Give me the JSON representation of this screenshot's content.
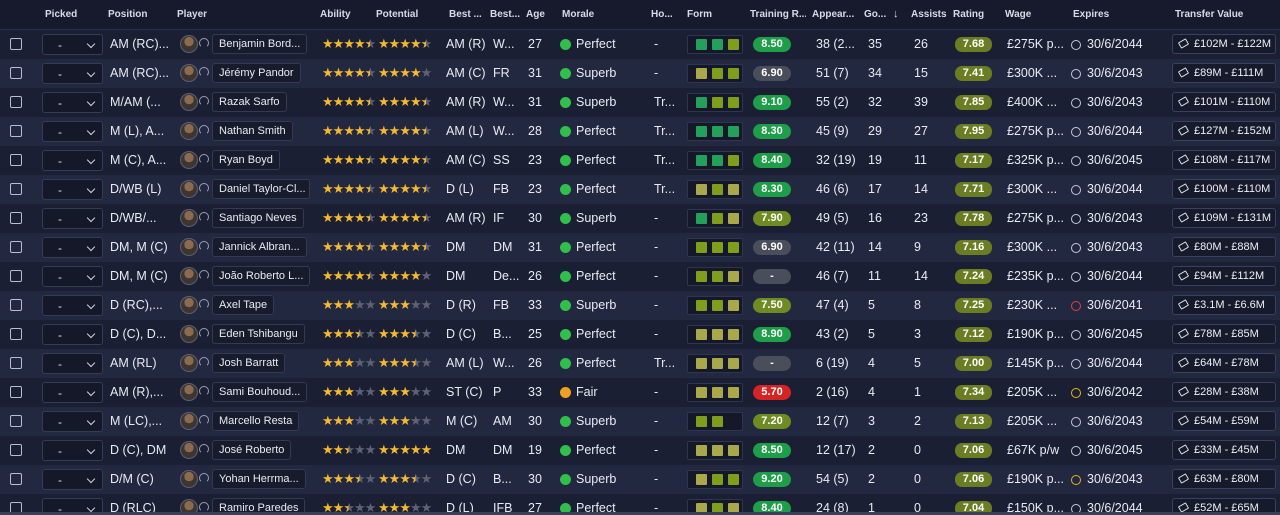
{
  "headers": {
    "picked": "Picked",
    "position": "Position",
    "player": "Player",
    "ability": "Ability",
    "potential": "Potential",
    "best_pos": "Best ...",
    "best_role": "Best...",
    "age": "Age",
    "morale": "Morale",
    "home": "Ho...",
    "form": "Form",
    "training": "Training R...",
    "appearances": "Appear...",
    "goals": "Go...",
    "assists": "Assists",
    "rating": "Rating",
    "wage": "Wage",
    "expires": "Expires",
    "transfer_value": "Transfer Value"
  },
  "colors": {
    "header_bg": "#161a2c",
    "row_odd": "#1a1f33",
    "row_even": "#222840",
    "star": "#f5b930",
    "morale_green": "#2fbf4a",
    "morale_yellow": "#f0a020",
    "rating_bg": "#6a7d23",
    "training_green": "#1e9e48",
    "training_grey": "#4a4d5a",
    "training_red": "#d42424",
    "form_green": "#23a05a",
    "form_olive": "#7f9e1c",
    "form_yellow": "#a9a84a"
  },
  "rows": [
    {
      "picked": "-",
      "position": "AM (RC)...",
      "player": "Benjamin Bord...",
      "ability": 4.5,
      "potential": 4.5,
      "best_pos": "AM (R)",
      "best_role": "W...",
      "age": "27",
      "morale": "Perfect",
      "morale_state": "good",
      "home": "-",
      "form": [
        "g",
        "g",
        "o"
      ],
      "training": "8.50",
      "training_state": "green",
      "apps": "38 (2...",
      "goals": "35",
      "assists": "26",
      "rating": "7.68",
      "wage": "£275K p...",
      "expires": "30/6/2044",
      "expires_state": "normal",
      "tv": "£102M - £122M"
    },
    {
      "picked": "-",
      "position": "AM (RC)...",
      "player": "Jérémy Pandor",
      "ability": 4.5,
      "potential": 4.0,
      "best_pos": "AM (C)",
      "best_role": "FR",
      "age": "31",
      "morale": "Superb",
      "morale_state": "good",
      "home": "-",
      "form": [
        "y",
        "o",
        "o"
      ],
      "training": "6.90",
      "training_state": "grey",
      "apps": "51 (7)",
      "goals": "34",
      "assists": "15",
      "rating": "7.41",
      "wage": "£300K ...",
      "expires": "30/6/2043",
      "expires_state": "normal",
      "tv": "£89M - £111M"
    },
    {
      "picked": "-",
      "position": "M/AM (...",
      "player": "Razak Sarfo",
      "ability": 4.5,
      "potential": 4.5,
      "best_pos": "AM (R)",
      "best_role": "W...",
      "age": "31",
      "morale": "Superb",
      "morale_state": "good",
      "home": "Tr...",
      "form": [
        "g",
        "o",
        "o"
      ],
      "training": "9.10",
      "training_state": "green",
      "apps": "55 (2)",
      "goals": "32",
      "assists": "39",
      "rating": "7.85",
      "wage": "£400K ...",
      "expires": "30/6/2043",
      "expires_state": "normal",
      "tv": "£101M - £110M"
    },
    {
      "picked": "-",
      "position": "M (L), A...",
      "player": "Nathan Smith",
      "ability": 4.5,
      "potential": 4.5,
      "best_pos": "AM (L)",
      "best_role": "W...",
      "age": "28",
      "morale": "Perfect",
      "morale_state": "good",
      "home": "Tr...",
      "form": [
        "g",
        "g",
        "g"
      ],
      "training": "8.30",
      "training_state": "green",
      "apps": "45 (9)",
      "goals": "29",
      "assists": "27",
      "rating": "7.95",
      "wage": "£275K p...",
      "expires": "30/6/2044",
      "expires_state": "normal",
      "tv": "£127M - £152M"
    },
    {
      "picked": "-",
      "position": "M (C), A...",
      "player": "Ryan Boyd",
      "ability": 4.5,
      "potential": 4.5,
      "best_pos": "AM (C)",
      "best_role": "SS",
      "age": "23",
      "morale": "Perfect",
      "morale_state": "good",
      "home": "Tr...",
      "form": [
        "g",
        "g",
        "o"
      ],
      "training": "8.40",
      "training_state": "green",
      "apps": "32 (19)",
      "goals": "19",
      "assists": "11",
      "rating": "7.17",
      "wage": "£325K p...",
      "expires": "30/6/2045",
      "expires_state": "normal",
      "tv": "£108M - £117M"
    },
    {
      "picked": "-",
      "position": "D/WB (L)",
      "player": "Daniel Taylor-Cl...",
      "ability": 4.5,
      "potential": 4.5,
      "best_pos": "D (L)",
      "best_role": "FB",
      "age": "23",
      "morale": "Perfect",
      "morale_state": "good",
      "home": "Tr...",
      "form": [
        "y",
        "o",
        "y"
      ],
      "training": "8.30",
      "training_state": "green",
      "apps": "46 (6)",
      "goals": "17",
      "assists": "14",
      "rating": "7.71",
      "wage": "£300K ...",
      "expires": "30/6/2044",
      "expires_state": "normal",
      "tv": "£100M - £110M"
    },
    {
      "picked": "-",
      "position": "D/WB/...",
      "player": "Santiago Neves",
      "ability": 4.5,
      "potential": 4.5,
      "best_pos": "AM (R)",
      "best_role": "IF",
      "age": "30",
      "morale": "Superb",
      "morale_state": "good",
      "home": "-",
      "form": [
        "g",
        "o",
        "y"
      ],
      "training": "7.90",
      "training_state": "olive",
      "apps": "49 (5)",
      "goals": "16",
      "assists": "23",
      "rating": "7.78",
      "wage": "£275K p...",
      "expires": "30/6/2043",
      "expires_state": "normal",
      "tv": "£109M - £131M"
    },
    {
      "picked": "-",
      "position": "DM, M (C)",
      "player": "Jannick Albran...",
      "ability": 4.5,
      "potential": 4.5,
      "best_pos": "DM",
      "best_role": "DM",
      "age": "31",
      "morale": "Perfect",
      "morale_state": "good",
      "home": "-",
      "form": [
        "o",
        "o",
        "o"
      ],
      "training": "6.90",
      "training_state": "grey",
      "apps": "42 (11)",
      "goals": "14",
      "assists": "9",
      "rating": "7.16",
      "wage": "£300K ...",
      "expires": "30/6/2043",
      "expires_state": "normal",
      "tv": "£80M - £88M"
    },
    {
      "picked": "-",
      "position": "DM, M (C)",
      "player": "João Roberto L...",
      "ability": 4.5,
      "potential": 4.0,
      "best_pos": "DM",
      "best_role": "De...",
      "age": "26",
      "morale": "Perfect",
      "morale_state": "good",
      "home": "-",
      "form": [
        "o",
        "o",
        "y"
      ],
      "training": "-",
      "training_state": "grey",
      "apps": "46 (7)",
      "goals": "11",
      "assists": "14",
      "rating": "7.24",
      "wage": "£235K p...",
      "expires": "30/6/2044",
      "expires_state": "normal",
      "tv": "£94M - £112M"
    },
    {
      "picked": "-",
      "position": "D (RC),...",
      "player": "Axel Tape",
      "ability": 3.0,
      "potential": 3.0,
      "best_pos": "D (R)",
      "best_role": "FB",
      "age": "33",
      "morale": "Superb",
      "morale_state": "good",
      "home": "-",
      "form": [
        "o",
        "o",
        "y"
      ],
      "training": "7.50",
      "training_state": "olive",
      "apps": "47 (4)",
      "goals": "5",
      "assists": "8",
      "rating": "7.25",
      "wage": "£230K ...",
      "expires": "30/6/2041",
      "expires_state": "red",
      "tv": "£3.1M - £6.6M"
    },
    {
      "picked": "-",
      "position": "D (C), D...",
      "player": "Eden Tshibangu",
      "ability": 3.5,
      "potential": 3.5,
      "best_pos": "D (C)",
      "best_role": "B...",
      "age": "25",
      "morale": "Perfect",
      "morale_state": "good",
      "home": "-",
      "form": [
        "y",
        "y",
        "y"
      ],
      "training": "8.90",
      "training_state": "green",
      "apps": "43 (2)",
      "goals": "5",
      "assists": "3",
      "rating": "7.12",
      "wage": "£190K p...",
      "expires": "30/6/2045",
      "expires_state": "normal",
      "tv": "£78M - £85M"
    },
    {
      "picked": "-",
      "position": "AM (RL)",
      "player": "Josh Barratt",
      "ability": 3.0,
      "potential": 3.5,
      "best_pos": "AM (L)",
      "best_role": "W...",
      "age": "26",
      "morale": "Perfect",
      "morale_state": "good",
      "home": "Tr...",
      "form": [
        "y",
        "y",
        "y"
      ],
      "training": "-",
      "training_state": "grey",
      "apps": "6 (19)",
      "goals": "4",
      "assists": "5",
      "rating": "7.00",
      "wage": "£145K p...",
      "expires": "30/6/2044",
      "expires_state": "normal",
      "tv": "£64M - £78M"
    },
    {
      "picked": "-",
      "position": "AM (R),...",
      "player": "Sami Bouhoud...",
      "ability": 3.0,
      "potential": 3.0,
      "best_pos": "ST (C)",
      "best_role": "P",
      "age": "33",
      "morale": "Fair",
      "morale_state": "fair",
      "home": "-",
      "form": [
        "y",
        "y",
        "y"
      ],
      "training": "5.70",
      "training_state": "red",
      "apps": "2 (16)",
      "goals": "4",
      "assists": "1",
      "rating": "7.34",
      "wage": "£205K ...",
      "expires": "30/6/2042",
      "expires_state": "yellow",
      "tv": "£28M - £38M"
    },
    {
      "picked": "-",
      "position": "M (LC),...",
      "player": "Marcello Resta",
      "ability": 3.0,
      "potential": 3.0,
      "best_pos": "M (C)",
      "best_role": "AM",
      "age": "30",
      "morale": "Superb",
      "morale_state": "good",
      "home": "-",
      "form": [
        "o",
        "o",
        "n"
      ],
      "training": "7.20",
      "training_state": "olive",
      "apps": "12 (7)",
      "goals": "3",
      "assists": "2",
      "rating": "7.13",
      "wage": "£205K ...",
      "expires": "30/6/2043",
      "expires_state": "normal",
      "tv": "£54M - £59M"
    },
    {
      "picked": "-",
      "position": "D (C), DM",
      "player": "José Roberto",
      "ability": 2.5,
      "potential": 5.0,
      "best_pos": "DM",
      "best_role": "DM",
      "age": "19",
      "morale": "Perfect",
      "morale_state": "good",
      "home": "-",
      "form": [
        "y",
        "y",
        "y"
      ],
      "training": "8.50",
      "training_state": "green",
      "apps": "12 (17)",
      "goals": "2",
      "assists": "0",
      "rating": "7.06",
      "wage": "£67K p/w",
      "expires": "30/6/2045",
      "expires_state": "normal",
      "tv": "£33M - £45M"
    },
    {
      "picked": "-",
      "position": "D/M (C)",
      "player": "Yohan Herrma...",
      "ability": 3.5,
      "potential": 3.5,
      "best_pos": "D (C)",
      "best_role": "B...",
      "age": "30",
      "morale": "Superb",
      "morale_state": "good",
      "home": "-",
      "form": [
        "y",
        "o",
        "o"
      ],
      "training": "9.20",
      "training_state": "green",
      "apps": "54 (5)",
      "goals": "2",
      "assists": "0",
      "rating": "7.06",
      "wage": "£190K p...",
      "expires": "30/6/2043",
      "expires_state": "yellow",
      "tv": "£63M - £80M"
    },
    {
      "picked": "-",
      "position": "D (RLC)",
      "player": "Ramiro Paredes",
      "ability": 2.5,
      "potential": 3.0,
      "best_pos": "D (L)",
      "best_role": "IFB",
      "age": "27",
      "morale": "Perfect",
      "morale_state": "good",
      "home": "-",
      "form": [
        "y",
        "o",
        "y"
      ],
      "training": "8.40",
      "training_state": "green",
      "apps": "24 (8)",
      "goals": "1",
      "assists": "0",
      "rating": "7.04",
      "wage": "£150K p...",
      "expires": "30/6/2044",
      "expires_state": "normal",
      "tv": "£52M - £65M"
    }
  ]
}
